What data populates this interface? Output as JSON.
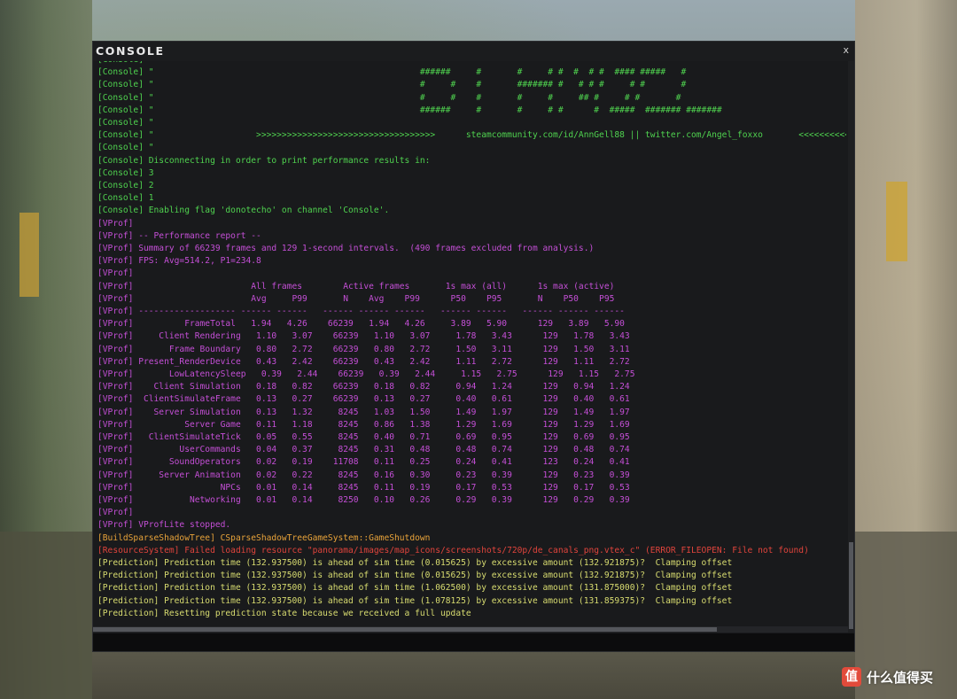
{
  "window": {
    "title": "CONSOLE",
    "close_label": "x"
  },
  "colors": {
    "green": "#4fd24f",
    "magenta": "#c44fd6",
    "orange": "#e8a33a",
    "red": "#e0443c",
    "yellow": "#d8dc70"
  },
  "lines": [
    {
      "text": "[Console]",
      "color": "green"
    },
    {
      "text": "[Console] \"                                                    ######     #       #     # #  #  # #  #### #####   #",
      "color": "green"
    },
    {
      "text": "[Console] \"                                                    #     #    #       ####### #   # # #     # #       #",
      "color": "green"
    },
    {
      "text": "[Console] \"                                                    #     #    #       #     #     ## #     # #       #",
      "color": "green"
    },
    {
      "text": "[Console] \"                                                    ######     #       #     # #      #  #####  ####### #######",
      "color": "green"
    },
    {
      "text": "[Console] \"",
      "color": "green"
    },
    {
      "text": "[Console] \"                    >>>>>>>>>>>>>>>>>>>>>>>>>>>>>>>>>>>      steamcommunity.com/id/AnnGell88 || twitter.com/Angel_foxxo       <<<<<<<<<<<<<<<<<<<<<<",
      "color": "green"
    },
    {
      "text": "[Console] \"",
      "color": "green"
    },
    {
      "text": "[Console] Disconnecting in order to print performance results in:",
      "color": "green"
    },
    {
      "text": "[Console] 3",
      "color": "green"
    },
    {
      "text": "[Console] 2",
      "color": "green"
    },
    {
      "text": "[Console] 1",
      "color": "green"
    },
    {
      "text": "[Console] Enabling flag 'donotecho' on channel 'Console'.",
      "color": "green"
    },
    {
      "text": "[VProf]",
      "color": "magenta"
    },
    {
      "text": "[VProf] -- Performance report --",
      "color": "magenta"
    },
    {
      "text": "[VProf] Summary of 66239 frames and 129 1-second intervals.  (490 frames excluded from analysis.)",
      "color": "magenta"
    },
    {
      "text": "[VProf] FPS: Avg=514.2, P1=234.8",
      "color": "magenta"
    },
    {
      "text": "[VProf]",
      "color": "magenta"
    },
    {
      "text": "[VProf]                       All frames        Active frames       1s max (all)      1s max (active)",
      "color": "magenta"
    },
    {
      "text": "[VProf]                       Avg     P99       N    Avg    P99      P50    P95       N    P50    P95",
      "color": "magenta"
    },
    {
      "text": "[VProf] ------------------- ------ ------   ------ ------ ------   ------ ------   ------ ------ ------",
      "color": "magenta"
    },
    {
      "text": "[VProf]          FrameTotal   1.94   4.26    66239   1.94   4.26     3.89   5.90      129   3.89   5.90",
      "color": "magenta"
    },
    {
      "text": "[VProf]     Client Rendering   1.10   3.07    66239   1.10   3.07     1.78   3.43      129   1.78   3.43",
      "color": "magenta"
    },
    {
      "text": "[VProf]       Frame Boundary   0.80   2.72    66239   0.80   2.72     1.50   3.11      129   1.50   3.11",
      "color": "magenta"
    },
    {
      "text": "[VProf] Present_RenderDevice   0.43   2.42    66239   0.43   2.42     1.11   2.72      129   1.11   2.72",
      "color": "magenta"
    },
    {
      "text": "[VProf]       LowLatencySleep   0.39   2.44    66239   0.39   2.44     1.15   2.75      129   1.15   2.75",
      "color": "magenta"
    },
    {
      "text": "[VProf]    Client Simulation   0.18   0.82    66239   0.18   0.82     0.94   1.24      129   0.94   1.24",
      "color": "magenta"
    },
    {
      "text": "[VProf]  ClientSimulateFrame   0.13   0.27    66239   0.13   0.27     0.40   0.61      129   0.40   0.61",
      "color": "magenta"
    },
    {
      "text": "[VProf]    Server Simulation   0.13   1.32     8245   1.03   1.50     1.49   1.97      129   1.49   1.97",
      "color": "magenta"
    },
    {
      "text": "[VProf]          Server Game   0.11   1.18     8245   0.86   1.38     1.29   1.69      129   1.29   1.69",
      "color": "magenta"
    },
    {
      "text": "[VProf]   ClientSimulateTick   0.05   0.55     8245   0.40   0.71     0.69   0.95      129   0.69   0.95",
      "color": "magenta"
    },
    {
      "text": "[VProf]         UserCommands   0.04   0.37     8245   0.31   0.48     0.48   0.74      129   0.48   0.74",
      "color": "magenta"
    },
    {
      "text": "[VProf]       SoundOperators   0.02   0.19    11708   0.11   0.25     0.24   0.41      123   0.24   0.41",
      "color": "magenta"
    },
    {
      "text": "[VProf]     Server Animation   0.02   0.22     8245   0.16   0.30     0.23   0.39      129   0.23   0.39",
      "color": "magenta"
    },
    {
      "text": "[VProf]                 NPCs   0.01   0.14     8245   0.11   0.19     0.17   0.53      129   0.17   0.53",
      "color": "magenta"
    },
    {
      "text": "[VProf]           Networking   0.01   0.14     8250   0.10   0.26     0.29   0.39      129   0.29   0.39",
      "color": "magenta"
    },
    {
      "text": "[VProf]",
      "color": "magenta"
    },
    {
      "text": "[VProf] VProfLite stopped.",
      "color": "magenta"
    },
    {
      "text": "[BuildSparseShadowTree] CSparseShadowTreeGameSystem::GameShutdown",
      "color": "orange"
    },
    {
      "text": "[ResourceSystem] Failed loading resource \"panorama/images/map_icons/screenshots/720p/de_canals_png.vtex_c\" (ERROR_FILEOPEN: File not found)",
      "color": "red"
    },
    {
      "text": "[Prediction] Prediction time (132.937500) is ahead of sim time (0.015625) by excessive amount (132.921875)?  Clamping offset",
      "color": "yellow"
    },
    {
      "text": "[Prediction] Prediction time (132.937500) is ahead of sim time (0.015625) by excessive amount (132.921875)?  Clamping offset",
      "color": "yellow"
    },
    {
      "text": "[Prediction] Prediction time (132.937500) is ahead of sim time (1.062500) by excessive amount (131.875000)?  Clamping offset",
      "color": "yellow"
    },
    {
      "text": "[Prediction] Prediction time (132.937500) is ahead of sim time (1.078125) by excessive amount (131.859375)?  Clamping offset",
      "color": "yellow"
    },
    {
      "text": "[Prediction] Resetting prediction state because we received a full update",
      "color": "yellow"
    }
  ],
  "input": {
    "value": ""
  },
  "watermark": {
    "logo_glyph": "值",
    "text": "什么值得买"
  }
}
